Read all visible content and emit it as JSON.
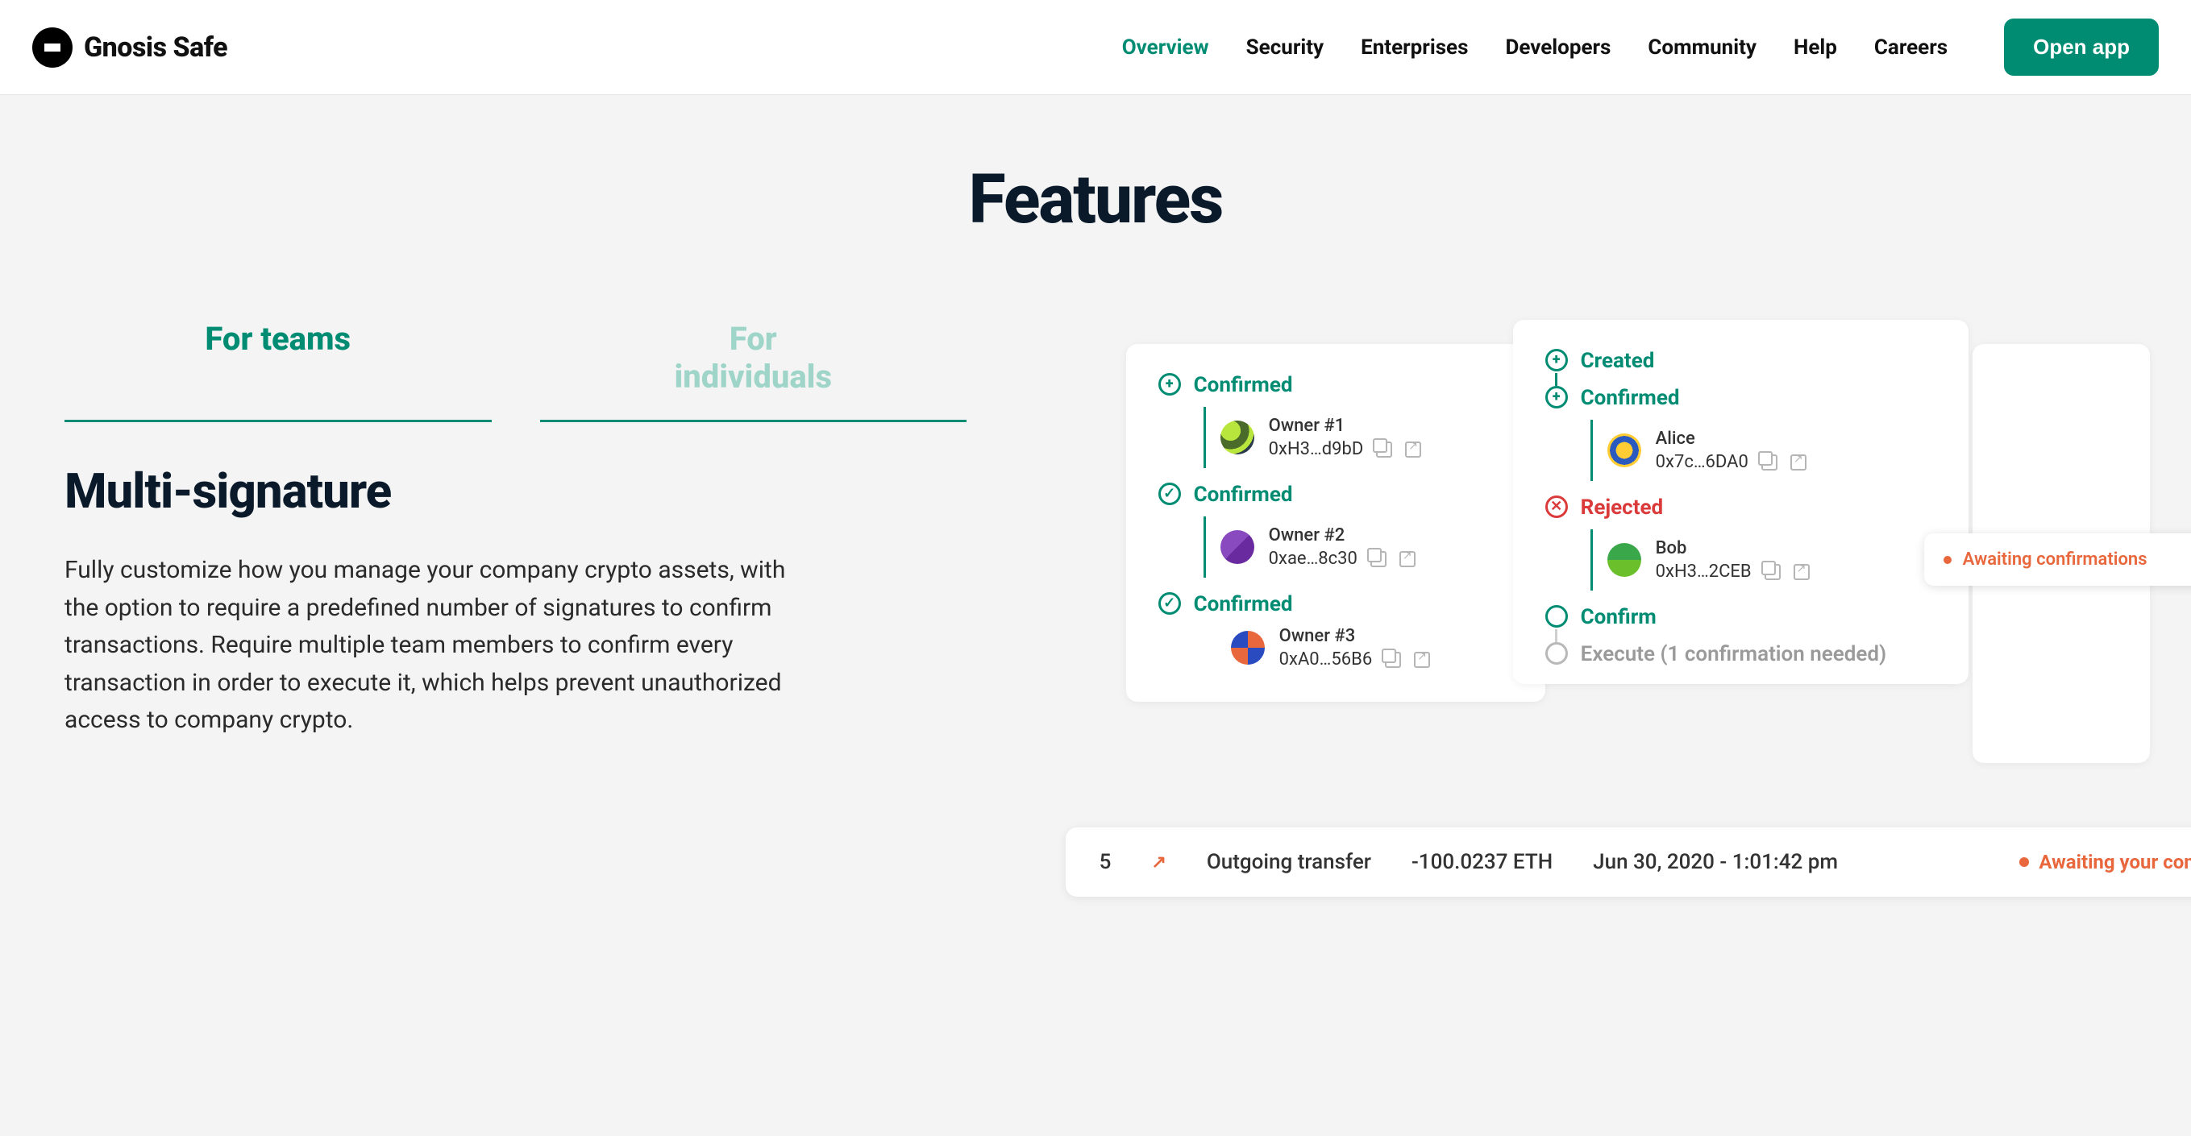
{
  "header": {
    "logo_text": "Gnosis Safe",
    "nav": [
      "Overview",
      "Security",
      "Enterprises",
      "Developers",
      "Community",
      "Help",
      "Careers"
    ],
    "nav_active": "Overview",
    "open_app": "Open app"
  },
  "page_title": "Features",
  "tabs": {
    "active": "For teams",
    "inactive": "For\nindividuals"
  },
  "feature": {
    "title": "Multi-signature",
    "desc": "Fully customize how you manage your company crypto assets, with the option to require a predefined number of signatures to confirm transactions. Require multiple team members to confirm every transaction in order to execute it, which helps prevent unauthorized access to company crypto."
  },
  "cardA": {
    "rows": [
      {
        "status": "Confirmed",
        "icon": "plus",
        "name": "Owner #1",
        "addr": "0xH3…d9bD"
      },
      {
        "status": "Confirmed",
        "icon": "check",
        "name": "Owner #2",
        "addr": "0xae…8c30"
      },
      {
        "status": "Confirmed",
        "icon": "check",
        "name": "Owner #3",
        "addr": "0xA0…56B6"
      }
    ]
  },
  "cardB": {
    "rows": [
      {
        "status": "Created",
        "icon": "plus",
        "type": "simple"
      },
      {
        "status": "Confirmed",
        "icon": "plus",
        "name": "Alice",
        "addr": "0x7c…6DA0"
      },
      {
        "status": "Rejected",
        "icon": "x",
        "color": "red",
        "name": "Bob",
        "addr": "0xH3…2CEB"
      },
      {
        "status": "Confirm",
        "icon": "o",
        "type": "simple"
      },
      {
        "status": "Execute (1 confirmation needed)",
        "icon": "o",
        "type": "simple",
        "gray": true
      }
    ]
  },
  "banner": "Awaiting confirmations",
  "tx": {
    "id": "5",
    "type": "Outgoing transfer",
    "amount": "-100.0237 ETH",
    "date": "Jun 30, 2020 - 1:01:42 pm",
    "status": "Awaiting your confirmation"
  }
}
